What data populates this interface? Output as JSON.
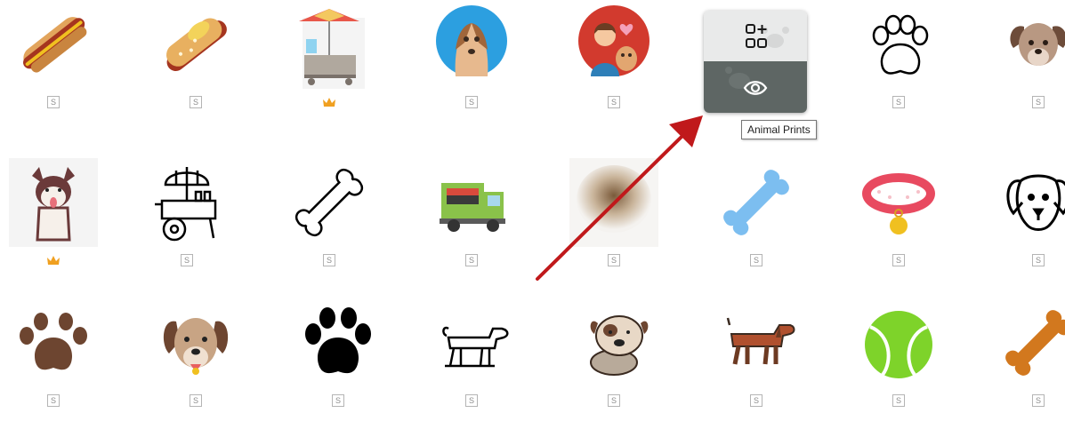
{
  "grid": {
    "rows": [
      [
        {
          "name": "hot-dog-icon",
          "badge": "S"
        },
        {
          "name": "hot-dog-mustard-icon",
          "badge": "S"
        },
        {
          "name": "hot-dog-cart-icon",
          "badge": "premium"
        },
        {
          "name": "dog-circle-icon",
          "badge": "S"
        },
        {
          "name": "dog-owner-icon",
          "badge": "S"
        },
        {
          "name": "animal-prints-icon",
          "badge": "S"
        },
        {
          "name": "paw-outline-icon",
          "badge": "S"
        },
        {
          "name": "dog-face-icon",
          "badge": "S"
        }
      ],
      [
        {
          "name": "husky-icon",
          "badge": "premium"
        },
        {
          "name": "food-cart-umbrella-icon",
          "badge": "S"
        },
        {
          "name": "bone-outline-icon",
          "badge": "S"
        },
        {
          "name": "food-truck-icon",
          "badge": "S"
        },
        {
          "name": "blurred-icon",
          "badge": "S"
        },
        {
          "name": "bone-blue-icon",
          "badge": "S"
        },
        {
          "name": "dog-collar-icon",
          "badge": "S"
        },
        {
          "name": "dog-face-outline-icon",
          "badge": "S"
        }
      ],
      [
        {
          "name": "paw-brown-icon",
          "badge": "S"
        },
        {
          "name": "dog-face-brown-icon",
          "badge": "S"
        },
        {
          "name": "paw-black-icon",
          "badge": "S"
        },
        {
          "name": "dog-walking-outline-icon",
          "badge": "S"
        },
        {
          "name": "bulldog-icon",
          "badge": "S"
        },
        {
          "name": "dachshund-icon",
          "badge": "S"
        },
        {
          "name": "tennis-ball-icon",
          "badge": "S"
        },
        {
          "name": "bone-orange-icon",
          "badge": "S"
        }
      ]
    ]
  },
  "badge_text": "S",
  "hover": {
    "tooltip": "Animal Prints",
    "add_icon": "add-to-collection-icon",
    "view_icon": "eye-icon"
  },
  "colors": {
    "arrow": "#c0191b",
    "hover_dark": "#5e6664",
    "crown": "#f0a020"
  }
}
